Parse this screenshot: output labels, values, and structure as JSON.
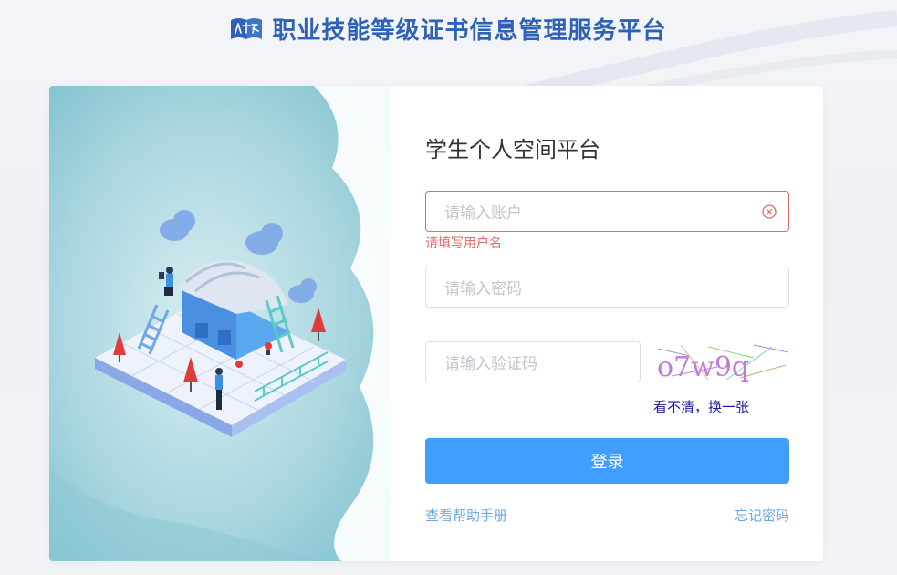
{
  "header": {
    "site_title": "职业技能等级证书信息管理服务平台"
  },
  "form": {
    "title": "学生个人空间平台",
    "account_placeholder": "请输入账户",
    "account_error": "请填写用户名",
    "password_placeholder": "请输入密码",
    "captcha_placeholder": "请输入验证码",
    "captcha_text": "o7w9q",
    "refresh_label": "看不清，换一张",
    "login_label": "登录",
    "help_link": "查看帮助手册",
    "forgot_link": "忘记密码"
  },
  "colors": {
    "brand": "#2e62b8",
    "primary": "#409eff",
    "error": "#e06b6b",
    "link": "#6aa8e8"
  }
}
